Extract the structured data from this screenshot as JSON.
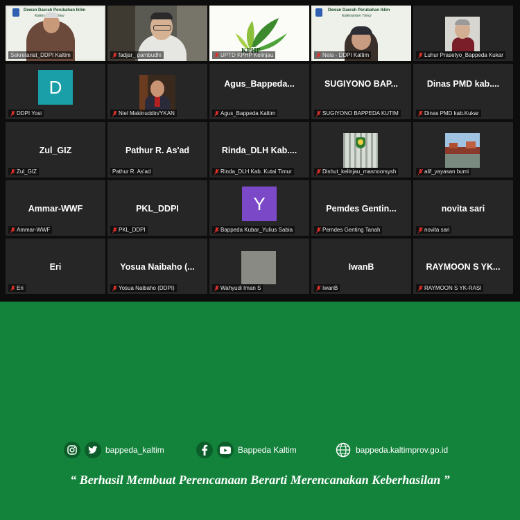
{
  "meeting": {
    "tiles": [
      {
        "label": "Sekretariat_DDPI Kaltim",
        "display_name": "",
        "kind": "video",
        "muted": false,
        "active": true
      },
      {
        "label": "fadjar_ pambudhi",
        "display_name": "",
        "kind": "video",
        "muted": true
      },
      {
        "label": "UPTD KPHP Kelinjau",
        "display_name": "",
        "kind": "video",
        "muted": true
      },
      {
        "label": "Nela - DDPI Kaltim",
        "display_name": "",
        "kind": "video",
        "muted": true
      },
      {
        "label": "Luhur Prasetyo_Bappeda Kukar",
        "display_name": "",
        "kind": "photo",
        "muted": true
      },
      {
        "label": "DDPI Yosi",
        "display_name": "",
        "kind": "avatar",
        "avatar_letter": "D",
        "avatar_color": "#1a9ea8",
        "muted": true
      },
      {
        "label": "Niel Makinuddin/YKAN",
        "display_name": "",
        "kind": "photo",
        "muted": true
      },
      {
        "label": "Agus_Bappeda Kaltim",
        "display_name": "Agus_Bappeda...",
        "kind": "name",
        "muted": true
      },
      {
        "label": "SUGIYONO BAPPEDA KUTIM",
        "display_name": "SUGIYONO BAP...",
        "kind": "name",
        "muted": true
      },
      {
        "label": "Dinas PMD kab.Kukar",
        "display_name": "Dinas PMD kab....",
        "kind": "name",
        "muted": true
      },
      {
        "label": "Zul_GIZ",
        "display_name": "Zul_GIZ",
        "kind": "name",
        "muted": true
      },
      {
        "label": "Pathur R. As'ad",
        "display_name": "Pathur R. As'ad",
        "kind": "name",
        "muted": false
      },
      {
        "label": "Rinda_DLH Kab. Kutai Timur",
        "display_name": "Rinda_DLH Kab....",
        "kind": "name",
        "muted": true
      },
      {
        "label": "Dishut_kelinjau_masnoorsysh",
        "display_name": "",
        "kind": "photo",
        "muted": true
      },
      {
        "label": "alif_yayasan bumi",
        "display_name": "",
        "kind": "photo",
        "muted": true
      },
      {
        "label": "Ammar-WWF",
        "display_name": "Ammar-WWF",
        "kind": "name",
        "muted": true
      },
      {
        "label": "PKL_DDPI",
        "display_name": "PKL_DDPI",
        "kind": "name",
        "muted": true
      },
      {
        "label": "Bappeda Kubar_Yulius Sabia",
        "display_name": "",
        "kind": "avatar",
        "avatar_letter": "Y",
        "avatar_color": "#7b49c8",
        "muted": true
      },
      {
        "label": "Pemdes Genting Tanah",
        "display_name": "Pemdes Gentin...",
        "kind": "name",
        "muted": true
      },
      {
        "label": "novita sari",
        "display_name": "novita sari",
        "kind": "name",
        "muted": true
      },
      {
        "label": "Eri",
        "display_name": "Eri",
        "kind": "name",
        "muted": true
      },
      {
        "label": "Yosua Naibaho (DDPI)",
        "display_name": "Yosua Naibaho (...",
        "kind": "name",
        "muted": true
      },
      {
        "label": "Wahyudi Iman S",
        "display_name": "",
        "kind": "photo",
        "muted": true
      },
      {
        "label": "IwanB",
        "display_name": "IwanB",
        "kind": "name",
        "muted": true
      },
      {
        "label": "RAYMOON S YK-RASI",
        "display_name": "RAYMOON S YK...",
        "kind": "name",
        "muted": true
      }
    ],
    "slide_text": {
      "title_a": "Dewan Daerah Perubahan Iklim",
      "title_b": "Kalimantan Timur",
      "logo_text": "KPHP"
    }
  },
  "footer": {
    "instagram_handle": "bappeda_kaltim",
    "facebook_youtube_name": "Bappeda Kaltim",
    "website": "bappeda.kaltimprov.go.id",
    "tagline": "“ Berhasil  Membuat Perencanaan Berarti Merencanakan Keberhasilan ”"
  },
  "colors": {
    "background_green": "#13823b",
    "grid_bg": "#0d0d0d",
    "tile_bg": "#262626",
    "mute_red": "#e0312b"
  }
}
